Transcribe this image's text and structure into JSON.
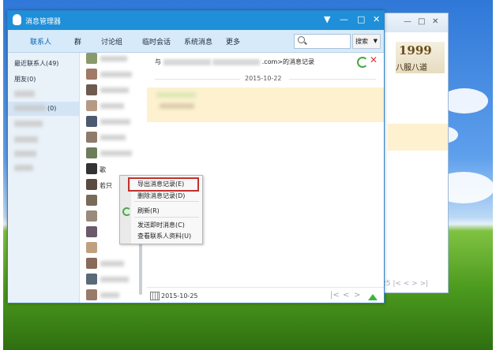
{
  "window": {
    "title": "消息管理器",
    "controls": [
      "▼",
      "—",
      "□",
      "✕"
    ]
  },
  "navbar": {
    "tabs": [
      "联系人",
      "群",
      "讨论组",
      "临时会话",
      "系统消息",
      "更多"
    ],
    "search_button": "搜索"
  },
  "groups": {
    "items": [
      "最近联系人(49)",
      "朋友(0)",
      "",
      "(0)"
    ]
  },
  "message_pane": {
    "header_prefix": "与",
    "header_suffix": ".com>的消息记录",
    "date_divider": "2015-10-22",
    "footer_date": "2015-10-25"
  },
  "contacts": {
    "visible_fragments": [
      "歌",
      "若只"
    ]
  },
  "context_menu": {
    "items": [
      "导出消息记录(E)",
      "删除消息记录(D)",
      "刷新(R)",
      "发送即时消息(C)",
      "查看联系人资料(U)"
    ]
  },
  "background_window": {
    "ad_number": "1999",
    "ad_text": "八服八道",
    "pager_number": "25"
  },
  "colors": {
    "title_bar": "#1e8fd8",
    "nav_bar": "#d6eafa",
    "highlight_row": "#fdf1cf",
    "menu_highlight_border": "#c0322e"
  }
}
